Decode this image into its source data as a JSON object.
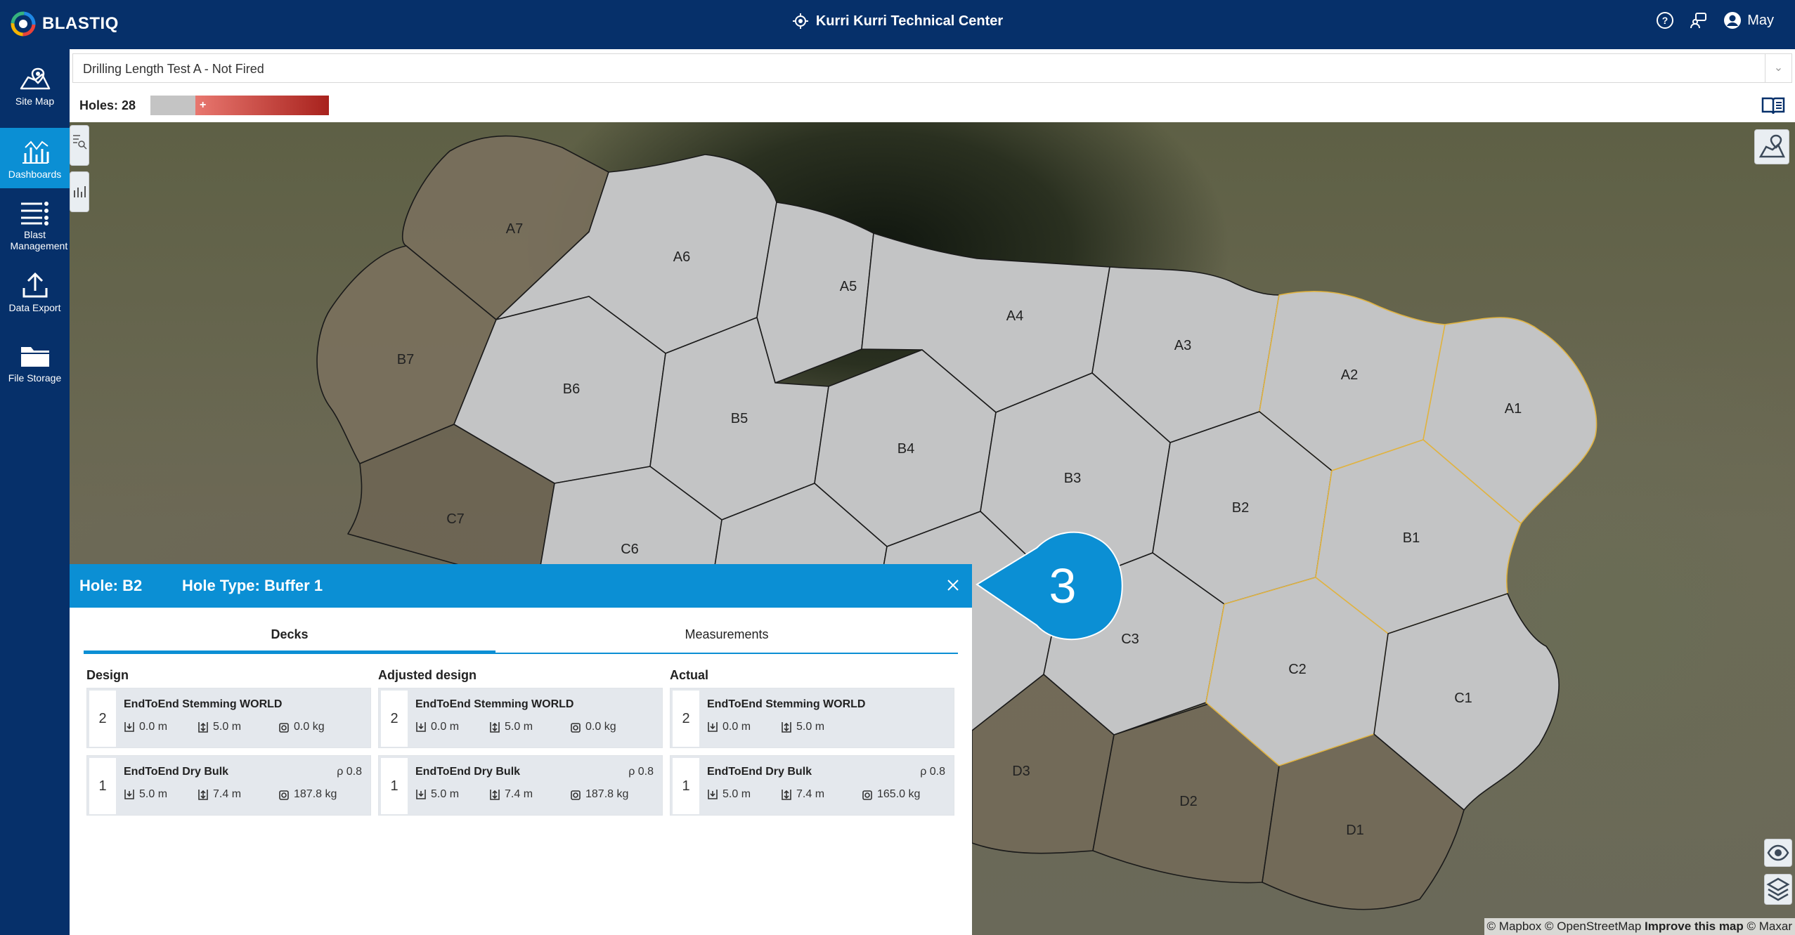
{
  "app": {
    "logo": "BLASTIQ",
    "site_name": "Kurri Kurri Technical Center",
    "user": "May"
  },
  "sidebar": [
    {
      "label": "Site Map",
      "icon": "map-icon"
    },
    {
      "label": "Dashboards",
      "icon": "dashboard-icon",
      "active": true
    },
    {
      "label": "Blast Management",
      "icon": "list-icon"
    },
    {
      "label": "Data Export",
      "icon": "upload-icon"
    },
    {
      "label": "File Storage",
      "icon": "folder-icon"
    }
  ],
  "blast": {
    "selected": "Drilling Length Test A - Not Fired",
    "holes_label": "Holes: 28",
    "legend_plus": "+"
  },
  "map": {
    "cells": [
      "A7",
      "A6",
      "A5",
      "A4",
      "A3",
      "A2",
      "A1",
      "B7",
      "B6",
      "B5",
      "B4",
      "B3",
      "B2",
      "B1",
      "C7",
      "C6",
      "C3",
      "C2",
      "C1",
      "D3",
      "D2",
      "D1"
    ],
    "attribution": {
      "mapbox": "© Mapbox",
      "osm": "© OpenStreetMap",
      "improve": "Improve this map",
      "maxar": "© Maxar"
    }
  },
  "callout": {
    "number": "3"
  },
  "panel": {
    "hole": "Hole: B2",
    "hole_type": "Hole Type: Buffer 1",
    "tabs": [
      "Decks",
      "Measurements"
    ],
    "columns": [
      {
        "title": "Design",
        "decks": [
          {
            "num": "2",
            "name": "EndToEnd Stemming WORLD",
            "rho": "",
            "top": "0.0 m",
            "length": "5.0 m",
            "mass": "0.0 kg"
          },
          {
            "num": "1",
            "name": "EndToEnd Dry Bulk",
            "rho": "ρ 0.8",
            "top": "5.0 m",
            "length": "7.4 m",
            "mass": "187.8 kg"
          }
        ]
      },
      {
        "title": "Adjusted design",
        "decks": [
          {
            "num": "2",
            "name": "EndToEnd Stemming WORLD",
            "rho": "",
            "top": "0.0 m",
            "length": "5.0 m",
            "mass": "0.0 kg"
          },
          {
            "num": "1",
            "name": "EndToEnd Dry Bulk",
            "rho": "ρ 0.8",
            "top": "5.0 m",
            "length": "7.4 m",
            "mass": "187.8 kg"
          }
        ]
      },
      {
        "title": "Actual",
        "decks": [
          {
            "num": "2",
            "name": "EndToEnd Stemming WORLD",
            "rho": "",
            "top": "0.0 m",
            "length": "5.0 m",
            "mass": ""
          },
          {
            "num": "1",
            "name": "EndToEnd Dry Bulk",
            "rho": "ρ 0.8",
            "top": "5.0 m",
            "length": "7.4 m",
            "mass": "165.0 kg"
          }
        ]
      }
    ]
  }
}
